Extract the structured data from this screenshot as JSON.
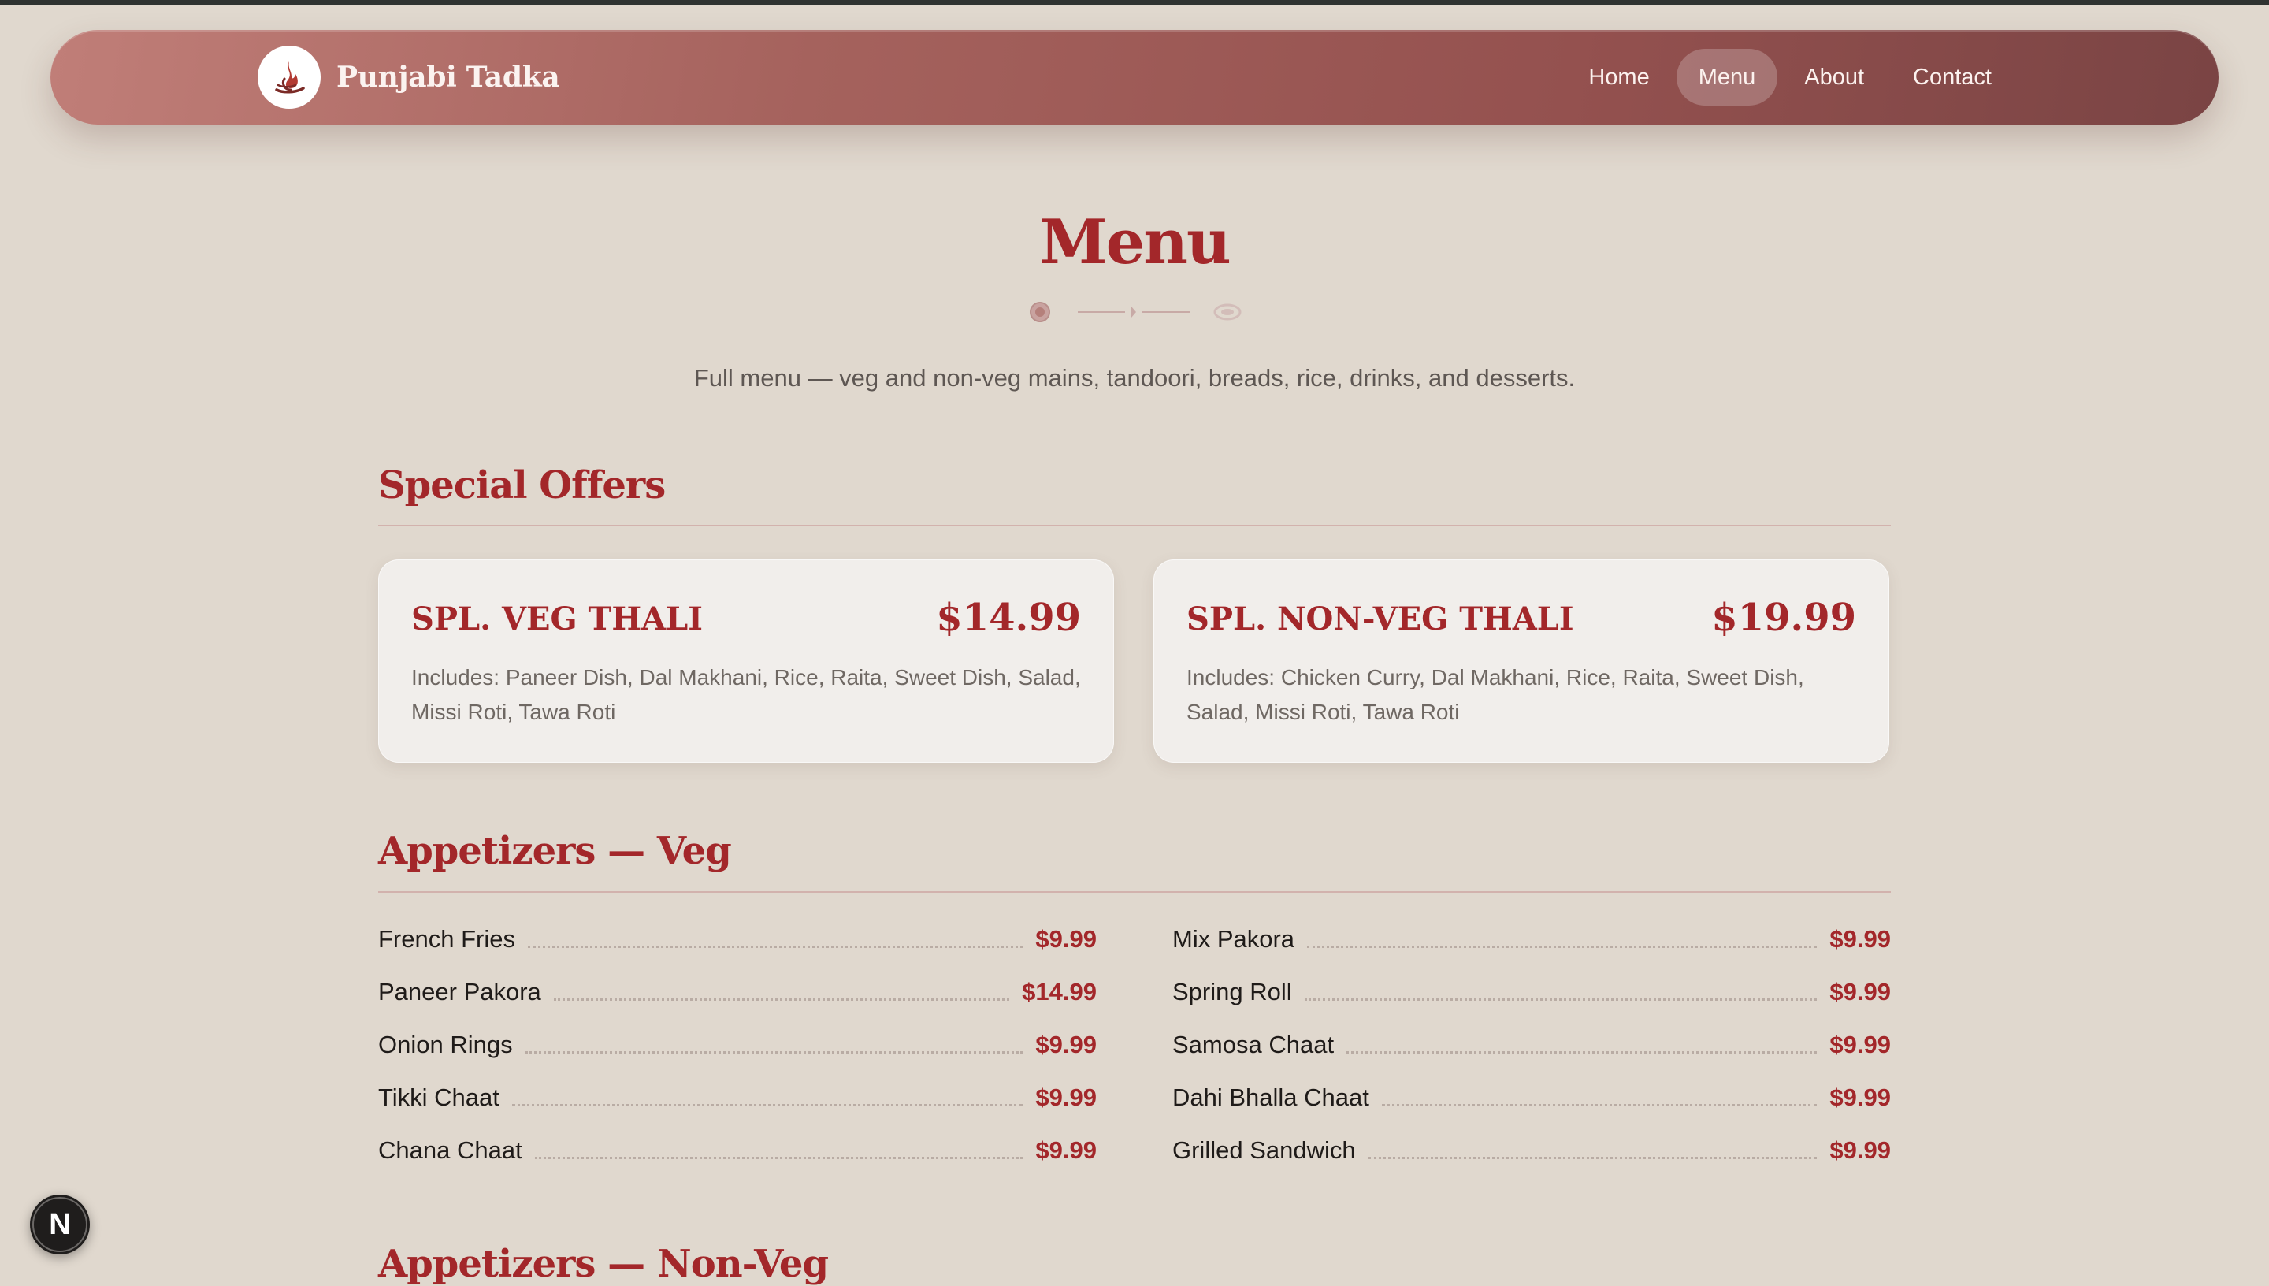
{
  "brand": {
    "name": "Punjabi Tadka",
    "logo_icon": "flame-logo-icon"
  },
  "nav": {
    "items": [
      {
        "label": "Home",
        "active": false
      },
      {
        "label": "Menu",
        "active": true
      },
      {
        "label": "About",
        "active": false
      },
      {
        "label": "Contact",
        "active": false
      }
    ]
  },
  "header": {
    "title": "Menu",
    "subtitle": "Full menu — veg and non-veg mains, tandoori, breads, rice, drinks, and desserts."
  },
  "special_offers": {
    "title": "Special Offers",
    "offers": [
      {
        "name": "SPL. VEG THALI",
        "price": "$14.99",
        "description": "Includes: Paneer Dish, Dal Makhani, Rice, Raita, Sweet Dish, Salad, Missi Roti, Tawa Roti"
      },
      {
        "name": "SPL. NON-VEG THALI",
        "price": "$19.99",
        "description": "Includes: Chicken Curry, Dal Makhani, Rice, Raita, Sweet Dish, Salad, Missi Roti, Tawa Roti"
      }
    ]
  },
  "appetizers_veg": {
    "title": "Appetizers — Veg",
    "left": [
      {
        "name": "French Fries",
        "price": "$9.99"
      },
      {
        "name": "Paneer Pakora",
        "price": "$14.99"
      },
      {
        "name": "Onion Rings",
        "price": "$9.99"
      },
      {
        "name": "Tikki Chaat",
        "price": "$9.99"
      },
      {
        "name": "Chana Chaat",
        "price": "$9.99"
      }
    ],
    "right": [
      {
        "name": "Mix Pakora",
        "price": "$9.99"
      },
      {
        "name": "Spring Roll",
        "price": "$9.99"
      },
      {
        "name": "Samosa Chaat",
        "price": "$9.99"
      },
      {
        "name": "Dahi Bhalla Chaat",
        "price": "$9.99"
      },
      {
        "name": "Grilled Sandwich",
        "price": "$9.99"
      }
    ]
  },
  "appetizers_nonveg": {
    "title": "Appetizers — Non-Veg"
  },
  "badge": {
    "label": "N"
  },
  "colors": {
    "accent": "#a3272a",
    "background": "#e0d8ce",
    "navbar": "#a5625d",
    "card": "#f1eeeb"
  }
}
